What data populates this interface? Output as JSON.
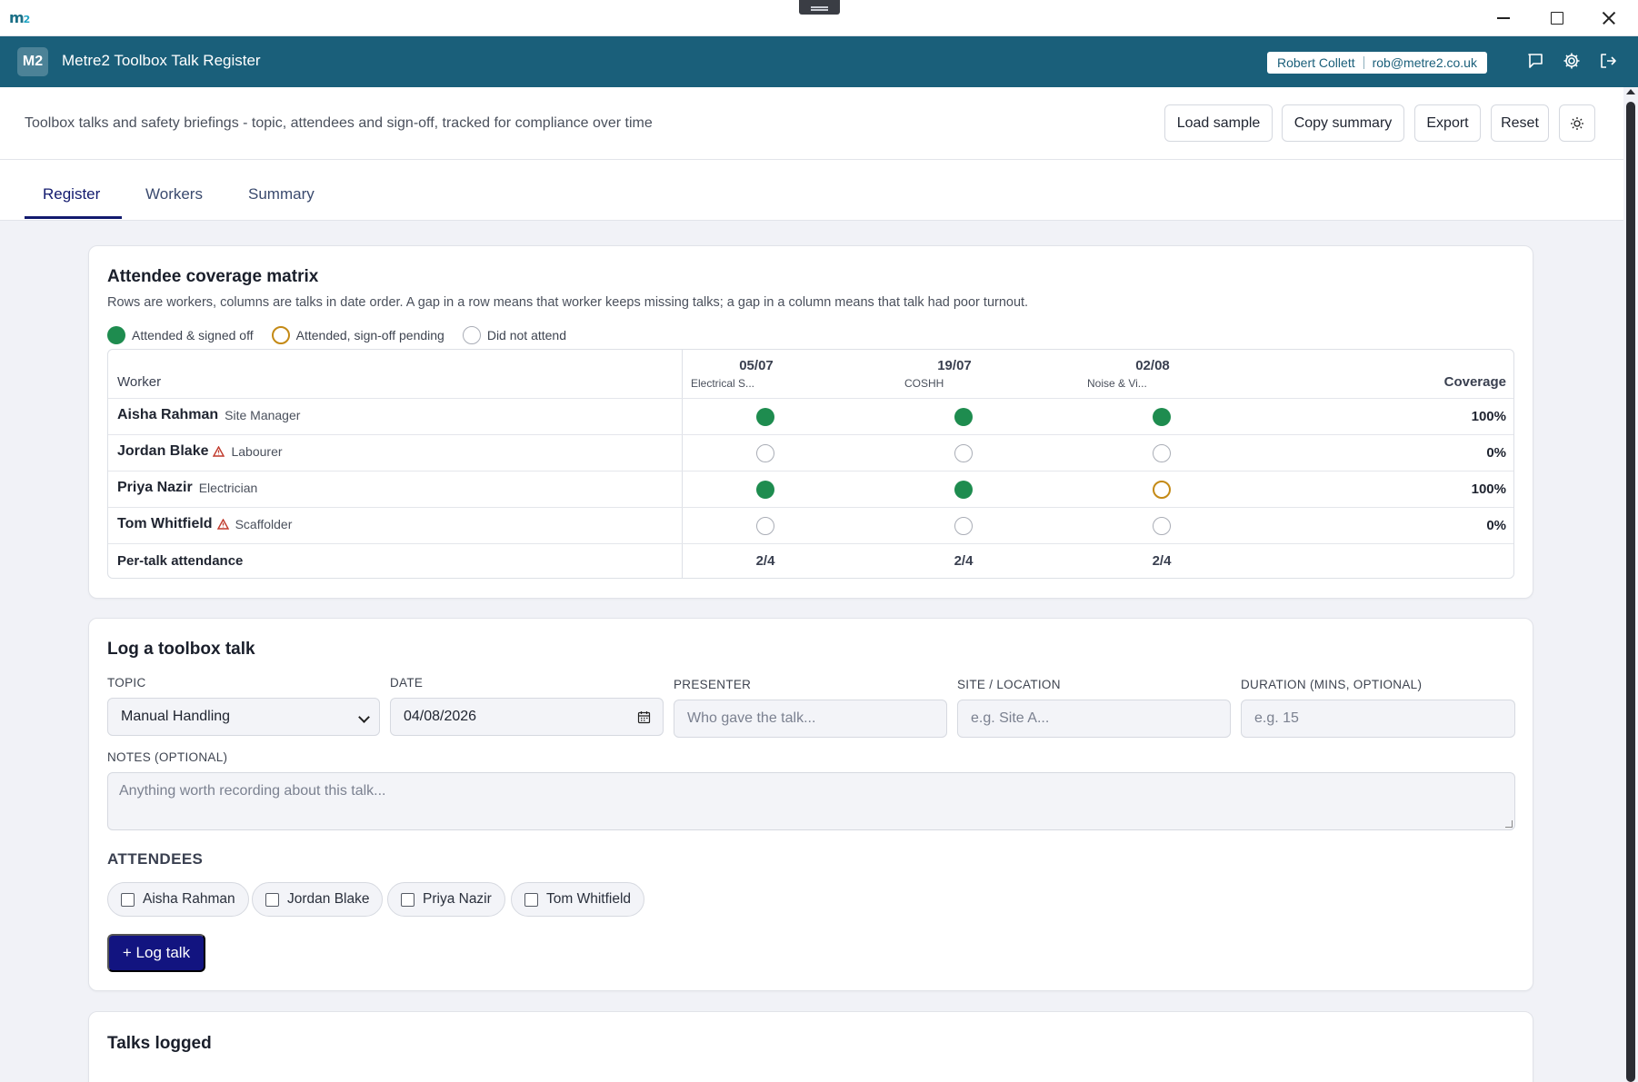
{
  "window": {
    "logo": "m",
    "logo_sup": "2"
  },
  "app": {
    "badge": "M2",
    "title": "Metre2 Toolbox Talk Register",
    "user_name": "Robert Collett",
    "user_email": "rob@metre2.co.uk"
  },
  "toolbar": {
    "subtitle": "Toolbox talks and safety briefings - topic, attendees and sign-off, tracked for compliance over time",
    "load_sample": "Load sample",
    "copy_summary": "Copy summary",
    "export": "Export",
    "reset": "Reset"
  },
  "tabs": [
    {
      "label": "Register",
      "active": true
    },
    {
      "label": "Workers",
      "active": false
    },
    {
      "label": "Summary",
      "active": false
    }
  ],
  "matrix": {
    "title": "Attendee coverage matrix",
    "description": "Rows are workers, columns are talks in date order. A gap in a row means that worker keeps missing talks; a gap in a column means that talk had poor turnout.",
    "legend": [
      "Attended & signed off",
      "Attended, sign-off pending",
      "Did not attend"
    ],
    "header_worker": "Worker",
    "header_coverage": "Coverage",
    "talks": [
      {
        "date": "05/07",
        "topic": "Electrical S..."
      },
      {
        "date": "19/07",
        "topic": "COSHH"
      },
      {
        "date": "02/08",
        "topic": "Noise & Vi..."
      }
    ],
    "rows": [
      {
        "name": "Aisha Rahman",
        "role": "Site Manager",
        "warning": false,
        "status": [
          "signed",
          "signed",
          "signed"
        ],
        "coverage": "100%"
      },
      {
        "name": "Jordan Blake",
        "role": "Labourer",
        "warning": true,
        "status": [
          "absent",
          "absent",
          "absent"
        ],
        "coverage": "0%"
      },
      {
        "name": "Priya Nazir",
        "role": "Electrician",
        "warning": false,
        "status": [
          "signed",
          "signed",
          "pending"
        ],
        "coverage": "100%"
      },
      {
        "name": "Tom Whitfield",
        "role": "Scaffolder",
        "warning": true,
        "status": [
          "absent",
          "absent",
          "absent"
        ],
        "coverage": "0%"
      }
    ],
    "attendance_label": "Per-talk attendance",
    "attendance": [
      "2/4",
      "2/4",
      "2/4"
    ],
    "colors": {
      "signed": "#1e8c4f",
      "pending": "#c48a16",
      "absent": "#a9adb6",
      "warning": "#c0392b"
    }
  },
  "log": {
    "title": "Log a toolbox talk",
    "topic_label": "TOPIC",
    "topic_value": "Manual Handling",
    "date_label": "DATE",
    "date_value": "04/08/2026",
    "presenter_label": "PRESENTER",
    "presenter_placeholder": "Who gave the talk...",
    "site_label": "SITE / LOCATION",
    "site_placeholder": "e.g. Site A...",
    "duration_label": "DURATION (MINS, OPTIONAL)",
    "duration_placeholder": "e.g. 15",
    "notes_label": "NOTES (OPTIONAL)",
    "notes_placeholder": "Anything worth recording about this talk...",
    "attendees_label": "ATTENDEES",
    "attendees": [
      "Aisha Rahman",
      "Jordan Blake",
      "Priya Nazir",
      "Tom Whitfield"
    ],
    "submit": "+ Log talk"
  },
  "talks": {
    "title": "Talks logged"
  }
}
